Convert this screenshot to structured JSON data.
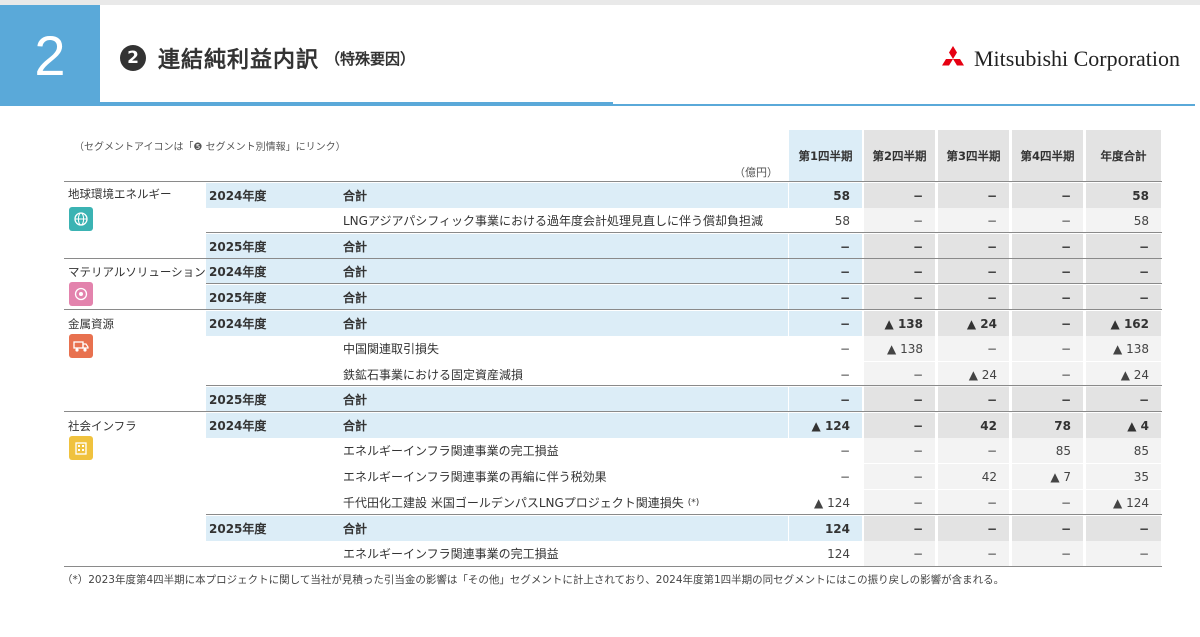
{
  "page": {
    "number": "2",
    "title_num": "2",
    "title": "連結純利益内訳",
    "title_sub": "（特殊要因）",
    "logo_text": "Mitsubishi Corporation",
    "note": "（セグメントアイコンは「❺ セグメント別情報」にリンク）",
    "unit": "（億円）",
    "footnote": "（*）2023年度第4四半期に本プロジェクトに関して当社が見積った引当金の影響は「その他」セグメントに計上されており、2024年度第1四半期の同セグメントにはこの振り戻しの影響が含まれる。",
    "icon_colors": {
      "energy": "#3bb3b3",
      "material": "#e383ad",
      "metal": "#e8714f",
      "infra": "#f0c23e"
    }
  },
  "columns": [
    "第1四半期",
    "第2四半期",
    "第3四半期",
    "第4四半期",
    "年度合計"
  ],
  "segments": [
    {
      "name": "地球環境エネルギー",
      "icon": "globe-icon"
    },
    {
      "name": "マテリアルソリューション",
      "icon": "material-icon"
    },
    {
      "name": "金属資源",
      "icon": "truck-icon"
    },
    {
      "name": "社会インフラ",
      "icon": "building-icon"
    }
  ],
  "rows": [
    {
      "year": "2024年度",
      "label": "合計",
      "values": [
        "58",
        "−",
        "−",
        "−",
        "58"
      ]
    },
    {
      "label": "LNGアジアパシフィック事業における過年度会計処理見直しに伴う償却負担減",
      "values": [
        "58",
        "−",
        "−",
        "−",
        "58"
      ]
    },
    {
      "year": "2025年度",
      "label": "合計",
      "values": [
        "−",
        "−",
        "−",
        "−",
        "−"
      ]
    },
    {
      "year": "2024年度",
      "label": "合計",
      "values": [
        "−",
        "−",
        "−",
        "−",
        "−"
      ]
    },
    {
      "year": "2025年度",
      "label": "合計",
      "values": [
        "−",
        "−",
        "−",
        "−",
        "−"
      ]
    },
    {
      "year": "2024年度",
      "label": "合計",
      "values": [
        "−",
        "▲ 138",
        "▲ 24",
        "−",
        "▲ 162"
      ]
    },
    {
      "label": "中国関連取引損失",
      "values": [
        "−",
        "▲ 138",
        "−",
        "−",
        "▲ 138"
      ]
    },
    {
      "label": "鉄鉱石事業における固定資産減損",
      "values": [
        "−",
        "−",
        "▲ 24",
        "−",
        "▲ 24"
      ]
    },
    {
      "year": "2025年度",
      "label": "合計",
      "values": [
        "−",
        "−",
        "−",
        "−",
        "−"
      ]
    },
    {
      "year": "2024年度",
      "label": "合計",
      "values": [
        "▲ 124",
        "−",
        "42",
        "78",
        "▲ 4"
      ]
    },
    {
      "label": "エネルギーインフラ関連事業の完工損益",
      "values": [
        "−",
        "−",
        "−",
        "85",
        "85"
      ]
    },
    {
      "label": "エネルギーインフラ関連事業の再編に伴う税効果",
      "values": [
        "−",
        "−",
        "42",
        "▲ 7",
        "35"
      ]
    },
    {
      "label": "千代田化工建設 米国ゴールデンパスLNGプロジェクト関連損失",
      "sup": "(*)",
      "values": [
        "▲ 124",
        "−",
        "−",
        "−",
        "▲ 124"
      ]
    },
    {
      "year": "2025年度",
      "label": "合計",
      "values": [
        "124",
        "−",
        "−",
        "−",
        "−"
      ]
    },
    {
      "label": "エネルギーインフラ関連事業の完工損益",
      "values": [
        "124",
        "−",
        "−",
        "−",
        "−"
      ]
    }
  ]
}
